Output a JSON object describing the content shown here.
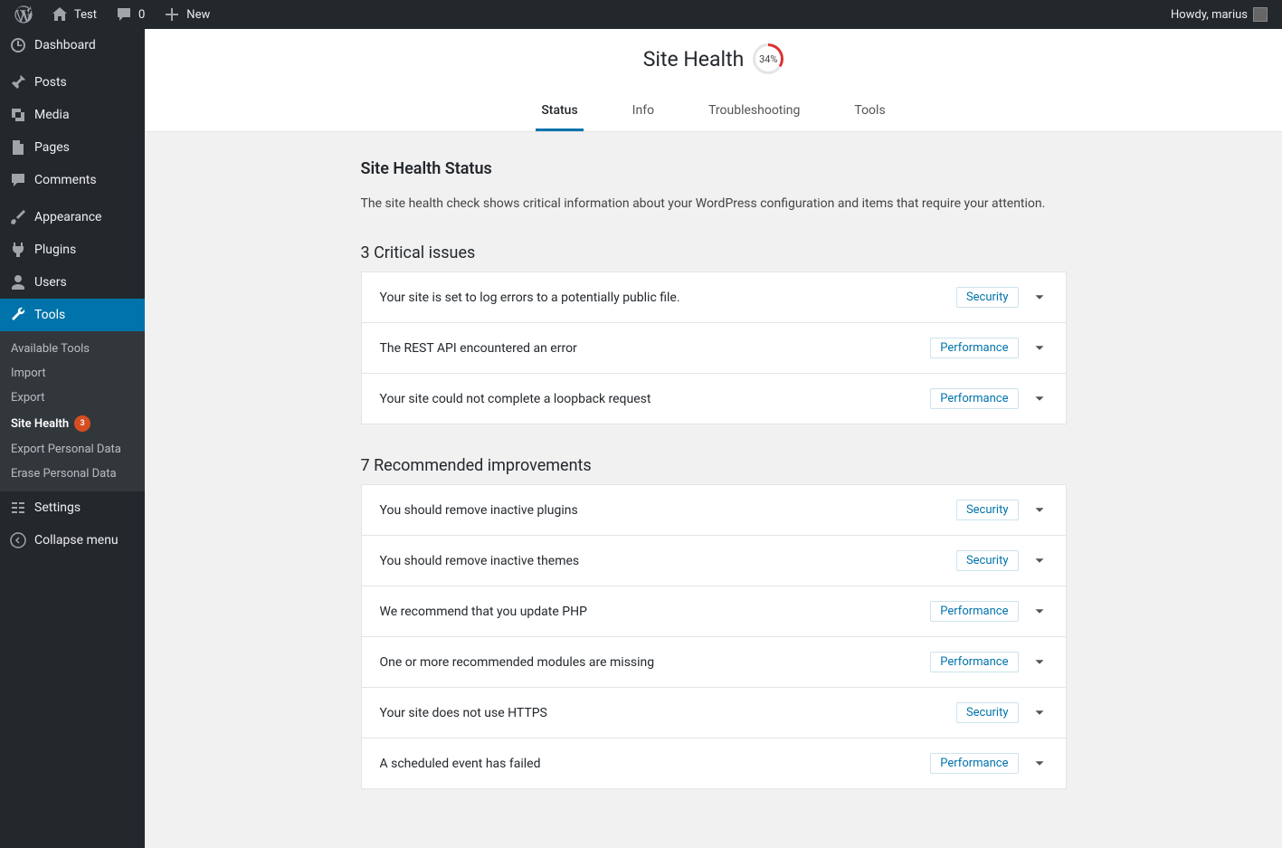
{
  "adminbar": {
    "site_name": "Test",
    "comments_count": "0",
    "new_label": "New",
    "greeting": "Howdy, marius"
  },
  "sidebar": {
    "items": [
      {
        "label": "Dashboard",
        "icon": "dashboard"
      },
      {
        "label": "Posts",
        "icon": "pin"
      },
      {
        "label": "Media",
        "icon": "media"
      },
      {
        "label": "Pages",
        "icon": "page"
      },
      {
        "label": "Comments",
        "icon": "comment"
      },
      {
        "label": "Appearance",
        "icon": "brush"
      },
      {
        "label": "Plugins",
        "icon": "plug"
      },
      {
        "label": "Users",
        "icon": "user"
      },
      {
        "label": "Tools",
        "icon": "wrench"
      },
      {
        "label": "Settings",
        "icon": "gear"
      }
    ],
    "tools_submenu": [
      {
        "label": "Available Tools"
      },
      {
        "label": "Import"
      },
      {
        "label": "Export"
      },
      {
        "label": "Site Health",
        "current": true,
        "badge": "3"
      },
      {
        "label": "Export Personal Data"
      },
      {
        "label": "Erase Personal Data"
      }
    ],
    "collapse_label": "Collapse menu"
  },
  "header": {
    "page_title": "Site Health",
    "progress_label": "34%",
    "tabs": [
      {
        "label": "Status",
        "active": true
      },
      {
        "label": "Info"
      },
      {
        "label": "Troubleshooting"
      },
      {
        "label": "Tools"
      }
    ]
  },
  "main": {
    "section_title": "Site Health Status",
    "section_desc": "The site health check shows critical information about your WordPress configuration and items that require your attention.",
    "critical_heading": "3 Critical issues",
    "critical_issues": [
      {
        "title": "Your site is set to log errors to a potentially public file.",
        "badge": "Security",
        "badge_type": "security"
      },
      {
        "title": "The REST API encountered an error",
        "badge": "Performance",
        "badge_type": "performance"
      },
      {
        "title": "Your site could not complete a loopback request",
        "badge": "Performance",
        "badge_type": "performance"
      }
    ],
    "recommended_heading": "7 Recommended improvements",
    "recommended_issues": [
      {
        "title": "You should remove inactive plugins",
        "badge": "Security",
        "badge_type": "security"
      },
      {
        "title": "You should remove inactive themes",
        "badge": "Security",
        "badge_type": "security"
      },
      {
        "title": "We recommend that you update PHP",
        "badge": "Performance",
        "badge_type": "performance"
      },
      {
        "title": "One or more recommended modules are missing",
        "badge": "Performance",
        "badge_type": "performance"
      },
      {
        "title": "Your site does not use HTTPS",
        "badge": "Security",
        "badge_type": "security"
      },
      {
        "title": "A scheduled event has failed",
        "badge": "Performance",
        "badge_type": "performance"
      }
    ]
  }
}
